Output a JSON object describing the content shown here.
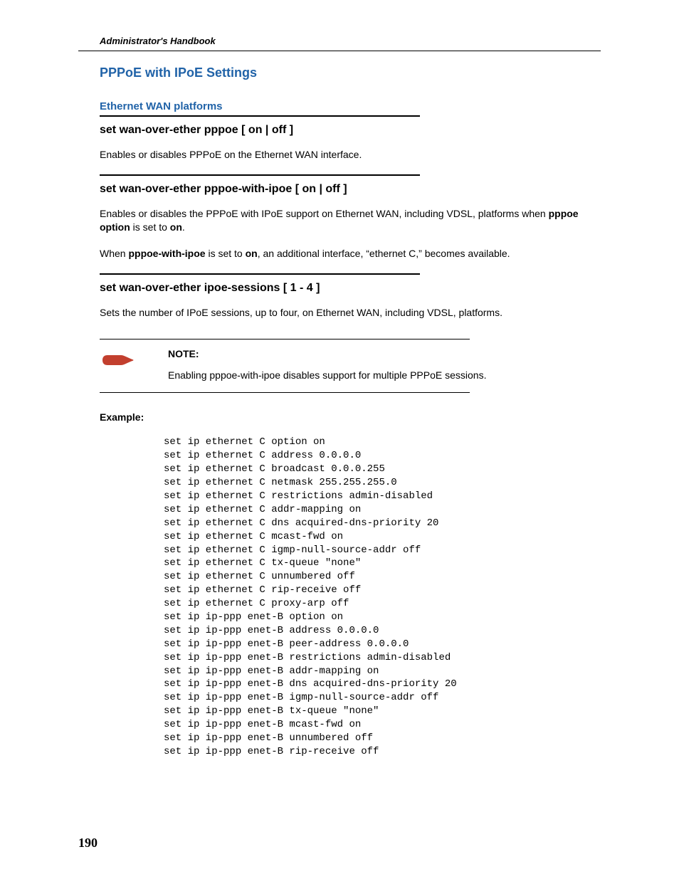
{
  "header": {
    "running_title": "Administrator's Handbook"
  },
  "title": "PPPoE with IPoE Settings",
  "subtitle": "Ethernet WAN platforms",
  "cmd1": {
    "heading": "set wan-over-ether pppoe [ on | off ]",
    "desc": "Enables or disables PPPoE on the Ethernet WAN interface."
  },
  "cmd2": {
    "heading": "set wan-over-ether pppoe-with-ipoe [ on | off ]",
    "desc_a": "Enables or disables the PPPoE with IPoE support on Ethernet WAN, including VDSL, platforms when ",
    "desc_b_bold": "pppoe option",
    "desc_c": " is set to ",
    "desc_d_bold": "on",
    "desc_e": ".",
    "desc2_a": "When ",
    "desc2_b_bold": "pppoe-with-ipoe",
    "desc2_c": " is set to ",
    "desc2_d_bold": "on",
    "desc2_e": ", an additional interface, “ethernet C,” becomes available."
  },
  "cmd3": {
    "heading": "set wan-over-ether ipoe-sessions [ 1 - 4 ]",
    "desc": "Sets the number of IPoE sessions, up to four, on Ethernet WAN, including VDSL, platforms."
  },
  "note": {
    "label": "NOTE:",
    "text": "Enabling pppoe-with-ipoe disables support for multiple PPPoE sessions."
  },
  "example": {
    "label": "Example:",
    "code": "set ip ethernet C option on\nset ip ethernet C address 0.0.0.0\nset ip ethernet C broadcast 0.0.0.255\nset ip ethernet C netmask 255.255.255.0\nset ip ethernet C restrictions admin-disabled\nset ip ethernet C addr-mapping on\nset ip ethernet C dns acquired-dns-priority 20\nset ip ethernet C mcast-fwd on\nset ip ethernet C igmp-null-source-addr off\nset ip ethernet C tx-queue \"none\"\nset ip ethernet C unnumbered off\nset ip ethernet C rip-receive off\nset ip ethernet C proxy-arp off\nset ip ip-ppp enet-B option on\nset ip ip-ppp enet-B address 0.0.0.0\nset ip ip-ppp enet-B peer-address 0.0.0.0\nset ip ip-ppp enet-B restrictions admin-disabled\nset ip ip-ppp enet-B addr-mapping on\nset ip ip-ppp enet-B dns acquired-dns-priority 20\nset ip ip-ppp enet-B igmp-null-source-addr off\nset ip ip-ppp enet-B tx-queue \"none\"\nset ip ip-ppp enet-B mcast-fwd on\nset ip ip-ppp enet-B unnumbered off\nset ip ip-ppp enet-B rip-receive off"
  },
  "page_number": "190"
}
